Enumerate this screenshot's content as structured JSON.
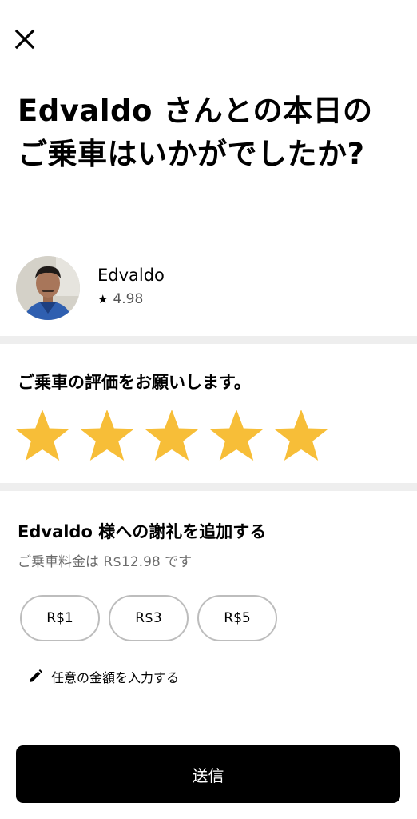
{
  "header": {
    "close_icon": "close-icon",
    "headline": "Edvaldo さんとの本日のご乗車はいかがでしたか?"
  },
  "driver": {
    "name": "Edvaldo",
    "rating": "4.98",
    "rating_icon": "star-icon"
  },
  "rating_section": {
    "title": "ご乗車の評価をお願いします。",
    "stars_total": 5,
    "stars_selected": 5,
    "star_color": "#F7BE38"
  },
  "tip_section": {
    "title": "Edvaldo 様への謝礼を追加する",
    "fare_note": "ご乗車料金は R$12.98 です",
    "options": [
      "R$1",
      "R$3",
      "R$5"
    ],
    "custom_label": "任意の金額を入力する",
    "custom_icon": "pencil-icon"
  },
  "submit": {
    "label": "送信"
  },
  "colors": {
    "divider": "#EEEEEE",
    "button_bg": "#000000",
    "chip_border": "#BDBDBD",
    "muted_text": "#6B6B6B"
  }
}
